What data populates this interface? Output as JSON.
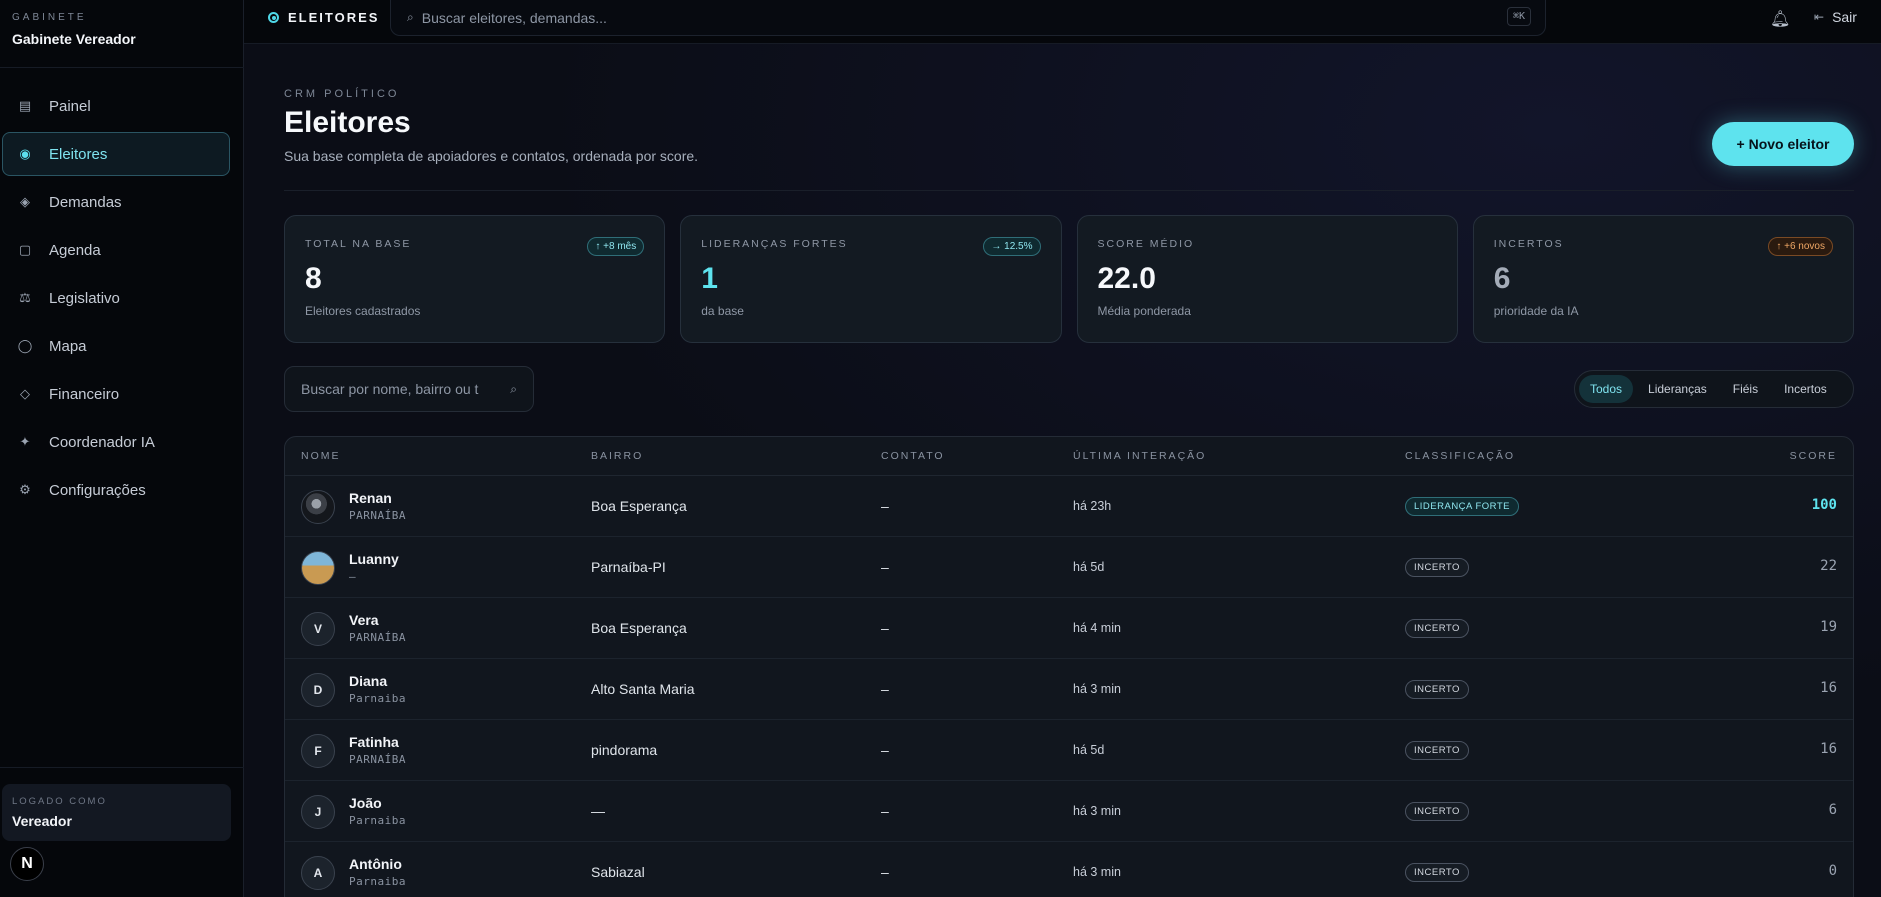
{
  "sidebar": {
    "brand_kicker": "GABINETE",
    "brand_name": "Gabinete Vereador",
    "items": [
      {
        "label": "Painel",
        "icon": "grid-icon"
      },
      {
        "label": "Eleitores",
        "icon": "target-icon"
      },
      {
        "label": "Demandas",
        "icon": "diamond-icon"
      },
      {
        "label": "Agenda",
        "icon": "square-icon"
      },
      {
        "label": "Legislativo",
        "icon": "scale-icon"
      },
      {
        "label": "Mapa",
        "icon": "circle-icon"
      },
      {
        "label": "Financeiro",
        "icon": "diamond-outline-icon"
      },
      {
        "label": "Coordenador IA",
        "icon": "sparkle-icon"
      },
      {
        "label": "Configurações",
        "icon": "gear-icon"
      }
    ],
    "active_item": "Eleitores",
    "logged_kicker": "LOGADO COMO",
    "logged_user": "Vereador",
    "badge_letter": "N"
  },
  "topbar": {
    "section": "ELEITORES",
    "search_placeholder": "Buscar eleitores, demandas...",
    "shortcut": "⌘K",
    "logout_label": "Sair"
  },
  "header": {
    "kicker": "CRM POLÍTICO",
    "title": "Eleitores",
    "subtitle": "Sua base completa de apoiadores e contatos, ordenada por score.",
    "new_button": "+ Novo eleitor"
  },
  "stats": [
    {
      "label": "TOTAL NA BASE",
      "value": "8",
      "desc": "Eleitores cadastrados",
      "pill": "↑ +8 mês"
    },
    {
      "label": "LIDERANÇAS FORTES",
      "value": "1",
      "desc": "da base",
      "pill": "→ 12.5%"
    },
    {
      "label": "SCORE MÉDIO",
      "value": "22.0",
      "desc": "Média ponderada",
      "pill": ""
    },
    {
      "label": "INCERTOS",
      "value": "6",
      "desc": "prioridade da IA",
      "pill": "↑ +6 novos"
    }
  ],
  "filters": {
    "search_placeholder": "Buscar por nome, bairro ou t",
    "segments": [
      "Todos",
      "Lideranças",
      "Fiéis",
      "Incertos"
    ],
    "active_segment": "Todos"
  },
  "table": {
    "columns": [
      "NOME",
      "BAIRRO",
      "CONTATO",
      "ÚLTIMA INTERAÇÃO",
      "CLASSIFICAÇÃO",
      "SCORE"
    ],
    "rows": [
      {
        "initial": "",
        "name": "Renan",
        "sub": "PARNAÍBA",
        "bairro": "Boa Esperança",
        "contato": "–",
        "ultima": "há 23h",
        "classificacao": "LIDERANÇA FORTE",
        "score": "100"
      },
      {
        "initial": "",
        "name": "Luanny",
        "sub": "–",
        "bairro": "Parnaíba-PI",
        "contato": "–",
        "ultima": "há 5d",
        "classificacao": "INCERTO",
        "score": "22"
      },
      {
        "initial": "V",
        "name": "Vera",
        "sub": "PARNAÍBA",
        "bairro": "Boa Esperança",
        "contato": "–",
        "ultima": "há 4 min",
        "classificacao": "INCERTO",
        "score": "19"
      },
      {
        "initial": "D",
        "name": "Diana",
        "sub": "Parnaiba",
        "bairro": "Alto Santa Maria",
        "contato": "–",
        "ultima": "há 3 min",
        "classificacao": "INCERTO",
        "score": "16"
      },
      {
        "initial": "F",
        "name": "Fatinha",
        "sub": "PARNAÍBA",
        "bairro": "pindorama",
        "contato": "–",
        "ultima": "há 5d",
        "classificacao": "INCERTO",
        "score": "16"
      },
      {
        "initial": "J",
        "name": "João",
        "sub": "Parnaiba",
        "bairro": "—",
        "contato": "–",
        "ultima": "há 3 min",
        "classificacao": "INCERTO",
        "score": "6"
      },
      {
        "initial": "A",
        "name": "Antônio",
        "sub": "Parnaiba",
        "bairro": "Sabiazal",
        "contato": "–",
        "ultima": "há 3 min",
        "classificacao": "INCERTO",
        "score": "0"
      }
    ]
  }
}
